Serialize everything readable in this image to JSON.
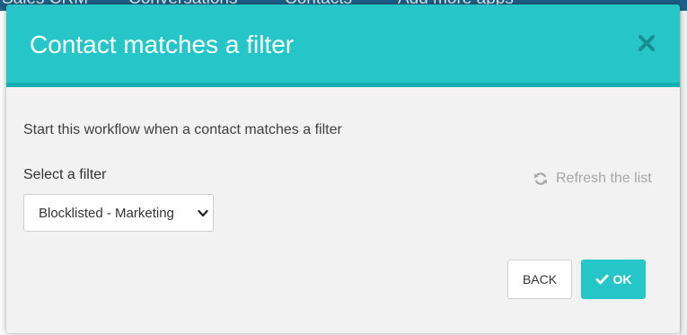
{
  "background": {
    "nav_items": [
      "Sales CRM",
      "Conversations",
      "Contacts",
      "Add more apps"
    ]
  },
  "modal": {
    "title": "Contact matches a filter",
    "close_icon": "close-icon",
    "intro_text": "Start this workflow when a contact matches a filter",
    "filter_label": "Select a filter",
    "refresh_label": "Refresh the list",
    "refresh_icon": "refresh-icon",
    "filter_select": {
      "selected_value": "Blocklisted - Marketing"
    },
    "back_label": "BACK",
    "ok_label": "OK",
    "ok_icon": "check-icon"
  },
  "colors": {
    "header": "#25c5c8",
    "header_border": "#14aeb3",
    "modal_body": "#f2f2f2",
    "ok_button": "#25c5c8",
    "refresh_text": "#a7a7a7",
    "nav_background": "#1f5f86"
  }
}
